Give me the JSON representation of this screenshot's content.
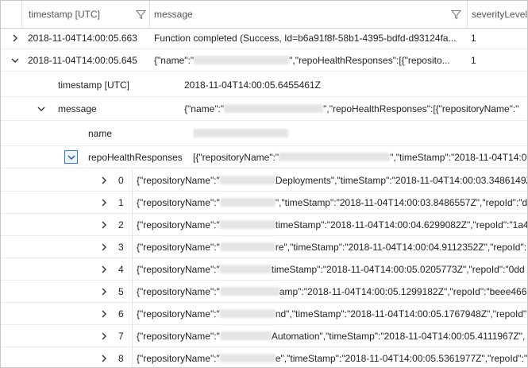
{
  "columns": {
    "timestamp": "timestamp [UTC]",
    "message": "message",
    "severity": "severityLevel"
  },
  "rows": [
    {
      "timestamp": "2018-11-04T14:00:05.663",
      "message": "Function completed (Success, Id=b6a91f8f-58b1-4395-bdfd-d93124fa...",
      "severity": "1"
    },
    {
      "timestamp": "2018-11-04T14:00:05.645",
      "message_pre": "{\"name\":\"",
      "message_post": "\",\"repoHealthResponses\":[{\"reposito...",
      "severity": "1"
    }
  ],
  "detail": {
    "timestamp_key": "timestamp [UTC]",
    "timestamp_value": "2018-11-04T14:00:05.6455461Z",
    "message_key": "message",
    "message_pre": "{\"name\":\"",
    "message_post": "\",\"repoHealthResponses\":[{\"repositoryName\":\"",
    "name_key": "name",
    "repo_key": "repoHealthResponses",
    "repo_pre": "[{\"repositoryName\":\"",
    "repo_post": "\",\"timeStamp\":\"2018-11-04T14:00:"
  },
  "items": [
    {
      "index": "0",
      "pre": "{\"repositoryName\":\"",
      "post": "Deployments\",\"timeStamp\":\"2018-11-04T14:00:03.3486149Z"
    },
    {
      "index": "1",
      "pre": "{\"repositoryName\":\"",
      "post": "\",\"timeStamp\":\"2018-11-04T14:00:03.8486557Z\",\"repoId\":\"d"
    },
    {
      "index": "2",
      "pre": "{\"repositoryName\":\"",
      "post": "timeStamp\":\"2018-11-04T14:00:04.6299082Z\",\"repoId\":\"1a4"
    },
    {
      "index": "3",
      "pre": "{\"repositoryName\":\"",
      "post": "re\",\"timeStamp\":\"2018-11-04T14:00:04.9112352Z\",\"repoId\":"
    },
    {
      "index": "4",
      "pre": "{\"repositoryName\":\"",
      "post": "timeStamp\":\"2018-11-04T14:00:05.0205773Z\",\"repoId\":\"0dd"
    },
    {
      "index": "5",
      "pre": "{\"repositoryName\":\"",
      "post": "amp\":\"2018-11-04T14:00:05.1299182Z\",\"repoId\":\"beee4662-"
    },
    {
      "index": "6",
      "pre": "{\"repositoryName\":\"",
      "post": "nd\",\"timeStamp\":\"2018-11-04T14:00:05.1767948Z\",\"repoId\":\""
    },
    {
      "index": "7",
      "pre": "{\"repositoryName\":\"",
      "post": "Automation\",\"timeStamp\":\"2018-11-04T14:00:05.4111967Z\","
    },
    {
      "index": "8",
      "pre": "{\"repositoryName\":\"",
      "post": "e\",\"timeStamp\":\"2018-11-04T14:00:05.5361977Z\",\"repoId\":\"f"
    }
  ]
}
